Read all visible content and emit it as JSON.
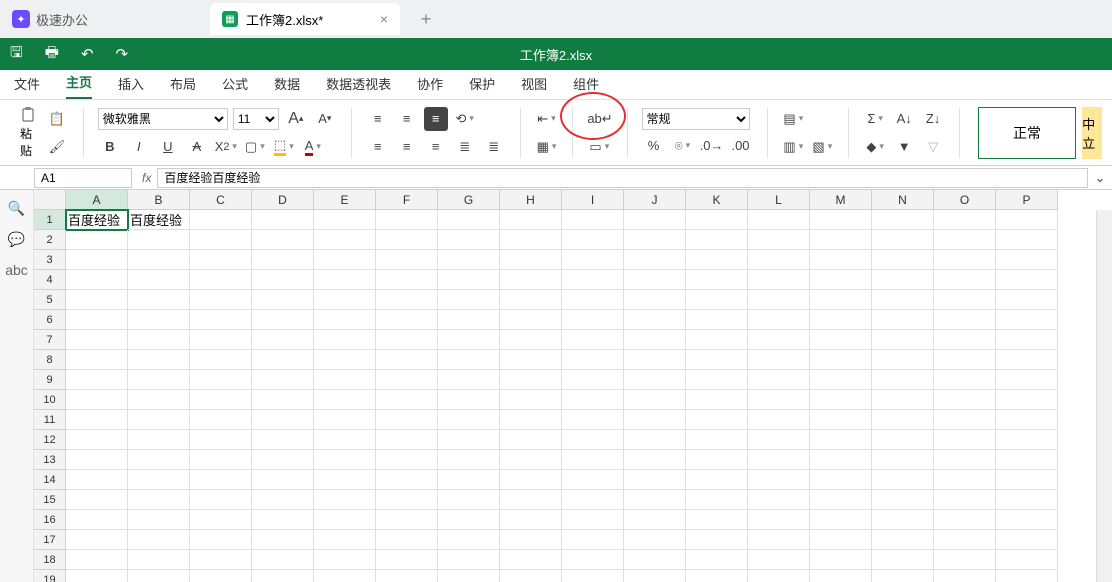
{
  "app_name": "极速办公",
  "tab": {
    "label": "工作簿2.xlsx*"
  },
  "window_title": "工作簿2.xlsx",
  "menu": {
    "items": [
      "文件",
      "主页",
      "插入",
      "布局",
      "公式",
      "数据",
      "数据透视表",
      "协作",
      "保护",
      "视图",
      "组件"
    ],
    "active": 1
  },
  "ribbon": {
    "paste": "粘贴",
    "font_name": "微软雅黑",
    "font_size": "11",
    "num_format": "常规",
    "style_normal": "正常",
    "style_neutral": "中立"
  },
  "formula": {
    "cell_ref": "A1",
    "value": "百度经验百度经验"
  },
  "sheet": {
    "cols": [
      "A",
      "B",
      "C",
      "D",
      "E",
      "F",
      "G",
      "H",
      "I",
      "J",
      "K",
      "L",
      "M",
      "N",
      "O",
      "P"
    ],
    "rows": 19,
    "active": {
      "r": 1,
      "c": 0
    },
    "cells": {
      "A1": "百度经验",
      "B1": "百度经验"
    }
  },
  "sidetools": [
    "🔍",
    "💬",
    "abc"
  ]
}
